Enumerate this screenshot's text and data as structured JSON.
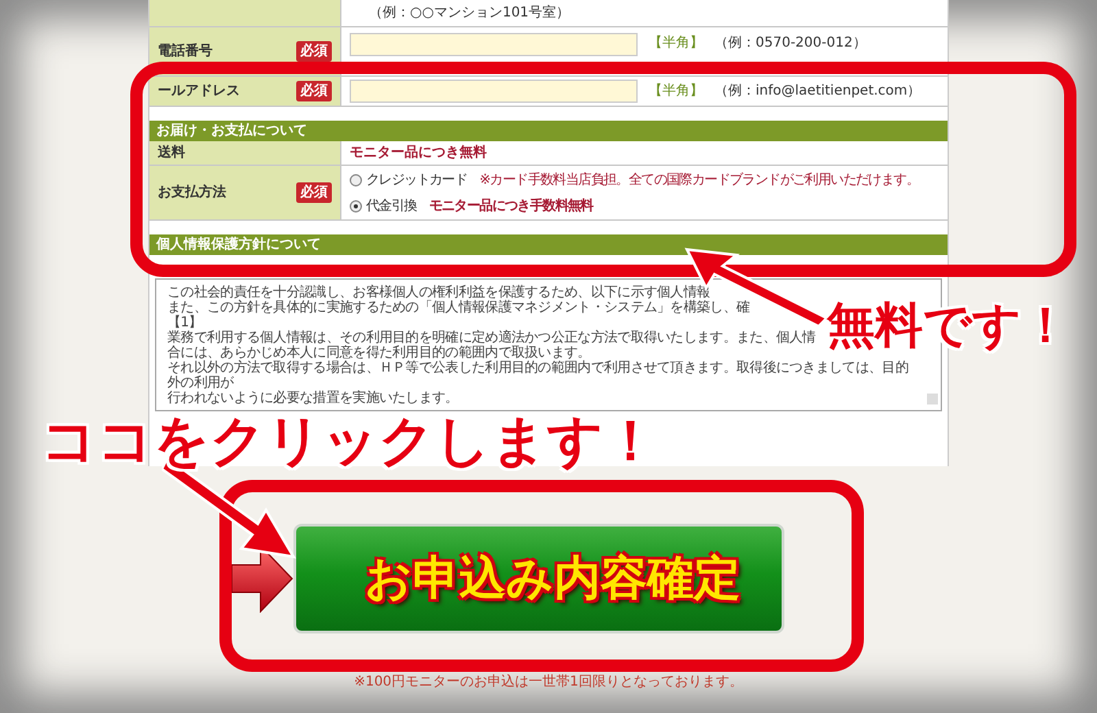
{
  "top_rows": [
    {
      "kind": "example_only",
      "example": "（例：○○マンション101号室）"
    },
    {
      "kind": "field",
      "label": "電話番号",
      "required_badge": "必須",
      "input_note": "【半角】",
      "example": "（例：0570-200-012）"
    },
    {
      "kind": "field",
      "label": "ールアドレス",
      "required_badge": "必須",
      "input_note": "【半角】",
      "example": "（例：info@laetitienpet.com）"
    }
  ],
  "delivery_section": {
    "title": "お届け・お支払について",
    "shipping": {
      "label": "送料",
      "value": "モニター品につき無料"
    },
    "payment": {
      "label": "お支払方法",
      "required_badge": "必須",
      "options": [
        {
          "label": "クレジットカード",
          "note": "※カード手数料当店負担。全ての国際カードブランドがご利用いただけます。",
          "selected": false
        },
        {
          "label": "代金引換",
          "note": "モニター品につき手数料無料",
          "selected": true
        }
      ]
    }
  },
  "privacy_section": {
    "title": "個人情報保護方針について",
    "policy_lines": [
      "この社会的責任を十分認識し、お客様個人の権利利益を保護するため、以下に示す個人情報",
      "また、この方針を具体的に実施するための「個人情報保護マネジメント・システム」を構築し、確",
      "【1】",
      "業務で利用する個人情報は、その利用目的を明確に定め適法かつ公正な方法で取得いたします。また、個人情",
      "合には、あらかじめ本人に同意を得た利用目的の範囲内で取扱います。",
      "それ以外の方法で取得する場合は、ＨＰ等で公表した利用目的の範囲内で利用させて頂きます。取得後につきましては、目的外の利用が",
      "行われないように必要な措置を実施いたします。"
    ]
  },
  "submit_button": {
    "label": "お申込み内容確定"
  },
  "footnote": "※100円モニターのお申込は一世帯1回限りとなっております。",
  "callouts": [
    "無料です！",
    "ココをクリックします！"
  ]
}
